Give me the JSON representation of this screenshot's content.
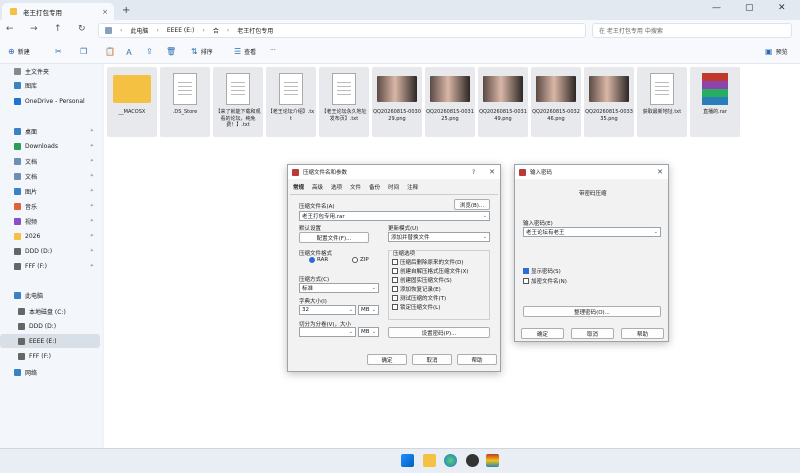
{
  "window": {
    "tab_title": "老王打包专用",
    "tab_close": "×",
    "new_tab": "+",
    "min": "—",
    "max": "▢",
    "close": "✕"
  },
  "nav": {
    "back": "←",
    "forward": "→",
    "up": "↑",
    "refresh": "↻",
    "breadcrumb": [
      "此电脑",
      "EEEE (E:)",
      "合",
      "老王打包专用"
    ],
    "search_placeholder": "在 老王打包专用 中搜索"
  },
  "commands": {
    "new": "新建",
    "sort": "排序",
    "view": "查看",
    "more": "···",
    "preview": "预览"
  },
  "sidebar": {
    "items": [
      {
        "label": "主文件夹",
        "icon": "home-icon"
      },
      {
        "label": "图库",
        "icon": "gallery-icon"
      },
      {
        "label": "OneDrive - Personal",
        "icon": "cloud-icon"
      },
      {
        "label": "桌面",
        "icon": "desktop-icon",
        "pinned": true
      },
      {
        "label": "Downloads",
        "icon": "download-icon",
        "pinned": true
      },
      {
        "label": "文档",
        "icon": "documents-icon",
        "pinned": true
      },
      {
        "label": "文档",
        "icon": "documents-icon",
        "pinned": true
      },
      {
        "label": "图片",
        "icon": "pictures-icon",
        "pinned": true
      },
      {
        "label": "音乐",
        "icon": "music-icon",
        "pinned": true
      },
      {
        "label": "视频",
        "icon": "videos-icon",
        "pinned": true
      },
      {
        "label": "2026",
        "icon": "folder-icon",
        "pinned": true
      },
      {
        "label": "DDD (D:)",
        "icon": "drive-icon",
        "pinned": true
      },
      {
        "label": "FFF (F:)",
        "icon": "drive-icon",
        "pinned": true
      },
      {
        "label": "此电脑",
        "icon": "pc-icon"
      },
      {
        "label": "本地磁盘 (C:)",
        "icon": "drive-icon"
      },
      {
        "label": "DDD (D:)",
        "icon": "drive-icon"
      },
      {
        "label": "EEEE (E:)",
        "icon": "drive-icon",
        "selected": true
      },
      {
        "label": "FFF (F:)",
        "icon": "drive-icon"
      },
      {
        "label": "网络",
        "icon": "network-icon"
      }
    ]
  },
  "files": [
    {
      "name": "__MACOSX",
      "type": "folder"
    },
    {
      "name": ".DS_Store",
      "type": "blank"
    },
    {
      "name": "【来了就能下载和观看的论坛，纯免费！】.txt",
      "type": "txt"
    },
    {
      "name": "【老王论坛介绍】.txt",
      "type": "txt"
    },
    {
      "name": "【老王论坛永久地址发布页】.txt",
      "type": "txt"
    },
    {
      "name": "QQ20260815-003029.png",
      "type": "png"
    },
    {
      "name": "QQ20260815-003125.png",
      "type": "png"
    },
    {
      "name": "QQ20260815-003149.png",
      "type": "png"
    },
    {
      "name": "QQ20260815-003246.png",
      "type": "png"
    },
    {
      "name": "QQ20260815-003335.png",
      "type": "png"
    },
    {
      "name": "获取最新地址.txt",
      "type": "txt"
    },
    {
      "name": "直播的.rar",
      "type": "rar"
    }
  ],
  "archive_dialog": {
    "title": "压缩文件名和参数",
    "help": "?",
    "close": "✕",
    "tabs": [
      "常规",
      "高级",
      "选项",
      "文件",
      "备份",
      "时间",
      "注释"
    ],
    "archive_name_label": "压缩文件名(A)",
    "browse": "浏览(B)...",
    "archive_name": "老王打包专用.rar",
    "default_settings_label": "默认设置",
    "profiles_button": "配置文件(F)...",
    "update_mode_label": "更新模式(U)",
    "update_mode": "添加并替换文件",
    "format_label": "压缩文件格式",
    "format_rar": "RAR",
    "format_zip": "ZIP",
    "method_label": "压缩方式(C)",
    "method": "标准",
    "dict_label": "字典大小(I)",
    "dict": "32",
    "dict_unit": "MB",
    "split_label": "切分为分卷(V)，大小",
    "split_unit": "MB",
    "options_label": "压缩选项",
    "options": [
      "压缩后删除原来的文件(D)",
      "创建自解压格式压缩文件(X)",
      "创建固实压缩文件(S)",
      "添加恢复记录(E)",
      "测试压缩的文件(T)",
      "锁定压缩文件(L)"
    ],
    "set_password": "设置密码(P)...",
    "ok": "确定",
    "cancel": "取消",
    "help_btn": "帮助"
  },
  "password_dialog": {
    "title": "输入密码",
    "close": "✕",
    "header": "带密码压缩",
    "enter_label": "输入密码(E)",
    "password": "老王论坛有老王",
    "show_password": "显示密码(S)",
    "encrypt_names": "加密文件名(N)",
    "organize": "整理密码(O)...",
    "ok": "确定",
    "cancel": "取消",
    "help_btn": "帮助"
  },
  "colors": {
    "accent": "#0067c0",
    "folder": "#f5c142",
    "selected": "#d9dfe7"
  }
}
